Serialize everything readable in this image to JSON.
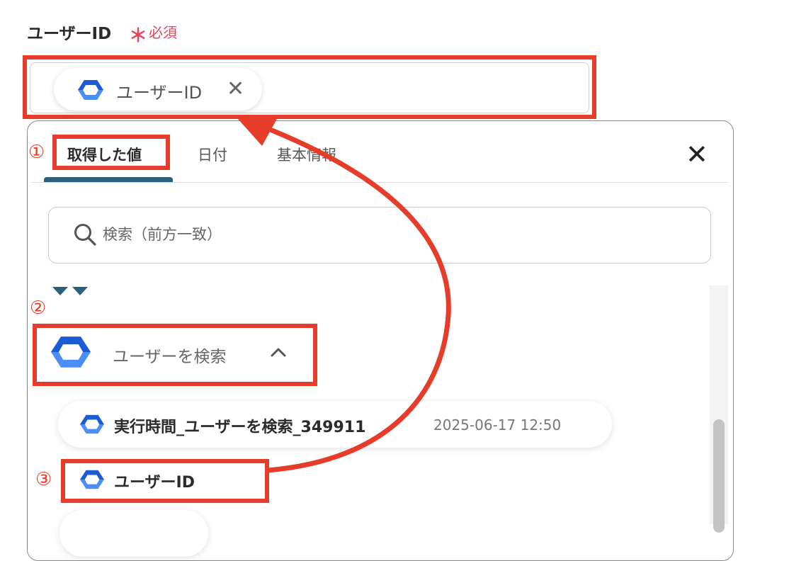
{
  "field": {
    "label": "ユーザーID",
    "required_mark": "＊",
    "required_text": "必須"
  },
  "chip": {
    "label": "ユーザーID",
    "remove_glyph": "✕"
  },
  "panel": {
    "tabs": [
      {
        "label": "取得した値",
        "active": true
      },
      {
        "label": "日付",
        "active": false
      },
      {
        "label": "基本情報",
        "active": false
      }
    ],
    "close_glyph": "✕",
    "search_placeholder": "検索（前方一致）",
    "section": {
      "label": "ユーザーを検索",
      "caret": "︿"
    },
    "items": [
      {
        "label": "実行時間_ユーザーを検索_349911",
        "value": "2025-06-17 12:50"
      },
      {
        "label": "ユーザーID",
        "value": ""
      }
    ]
  },
  "annotations": {
    "steps": [
      "①",
      "②",
      "③"
    ],
    "color": "#e53d2a"
  },
  "colors": {
    "accent_tab": "#2c5f7b",
    "required": "#e8425c",
    "cloud_icon_dark": "#1a5bd6",
    "cloud_icon_light": "#4c8df6"
  }
}
